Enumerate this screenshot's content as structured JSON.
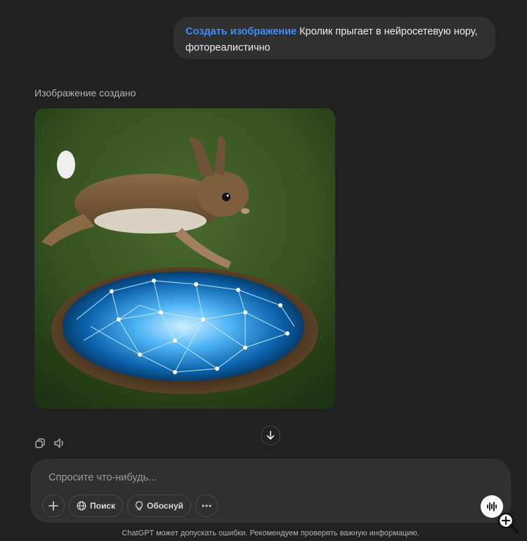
{
  "user_message": {
    "command": "Создать изображение",
    "text": "Кролик прыгает в нейросетевую нору, фотореалистично"
  },
  "assistant": {
    "status": "Изображение создано",
    "image_alt": "Кролик прыгает в нейросетевую нору"
  },
  "message_actions": {
    "copy_icon": "copy-icon",
    "read_aloud_icon": "speaker-icon"
  },
  "composer": {
    "placeholder": "Спросите что-нибудь...",
    "value": "",
    "tools": {
      "search_label": "Поиск",
      "reason_label": "Обоснуй"
    }
  },
  "footer": {
    "disclaimer": "ChatGPT может допускать ошибки. Рекомендуем проверять важную информацию."
  },
  "colors": {
    "background": "#212121",
    "bubble": "#303030",
    "command_accent": "#3d8df5"
  }
}
